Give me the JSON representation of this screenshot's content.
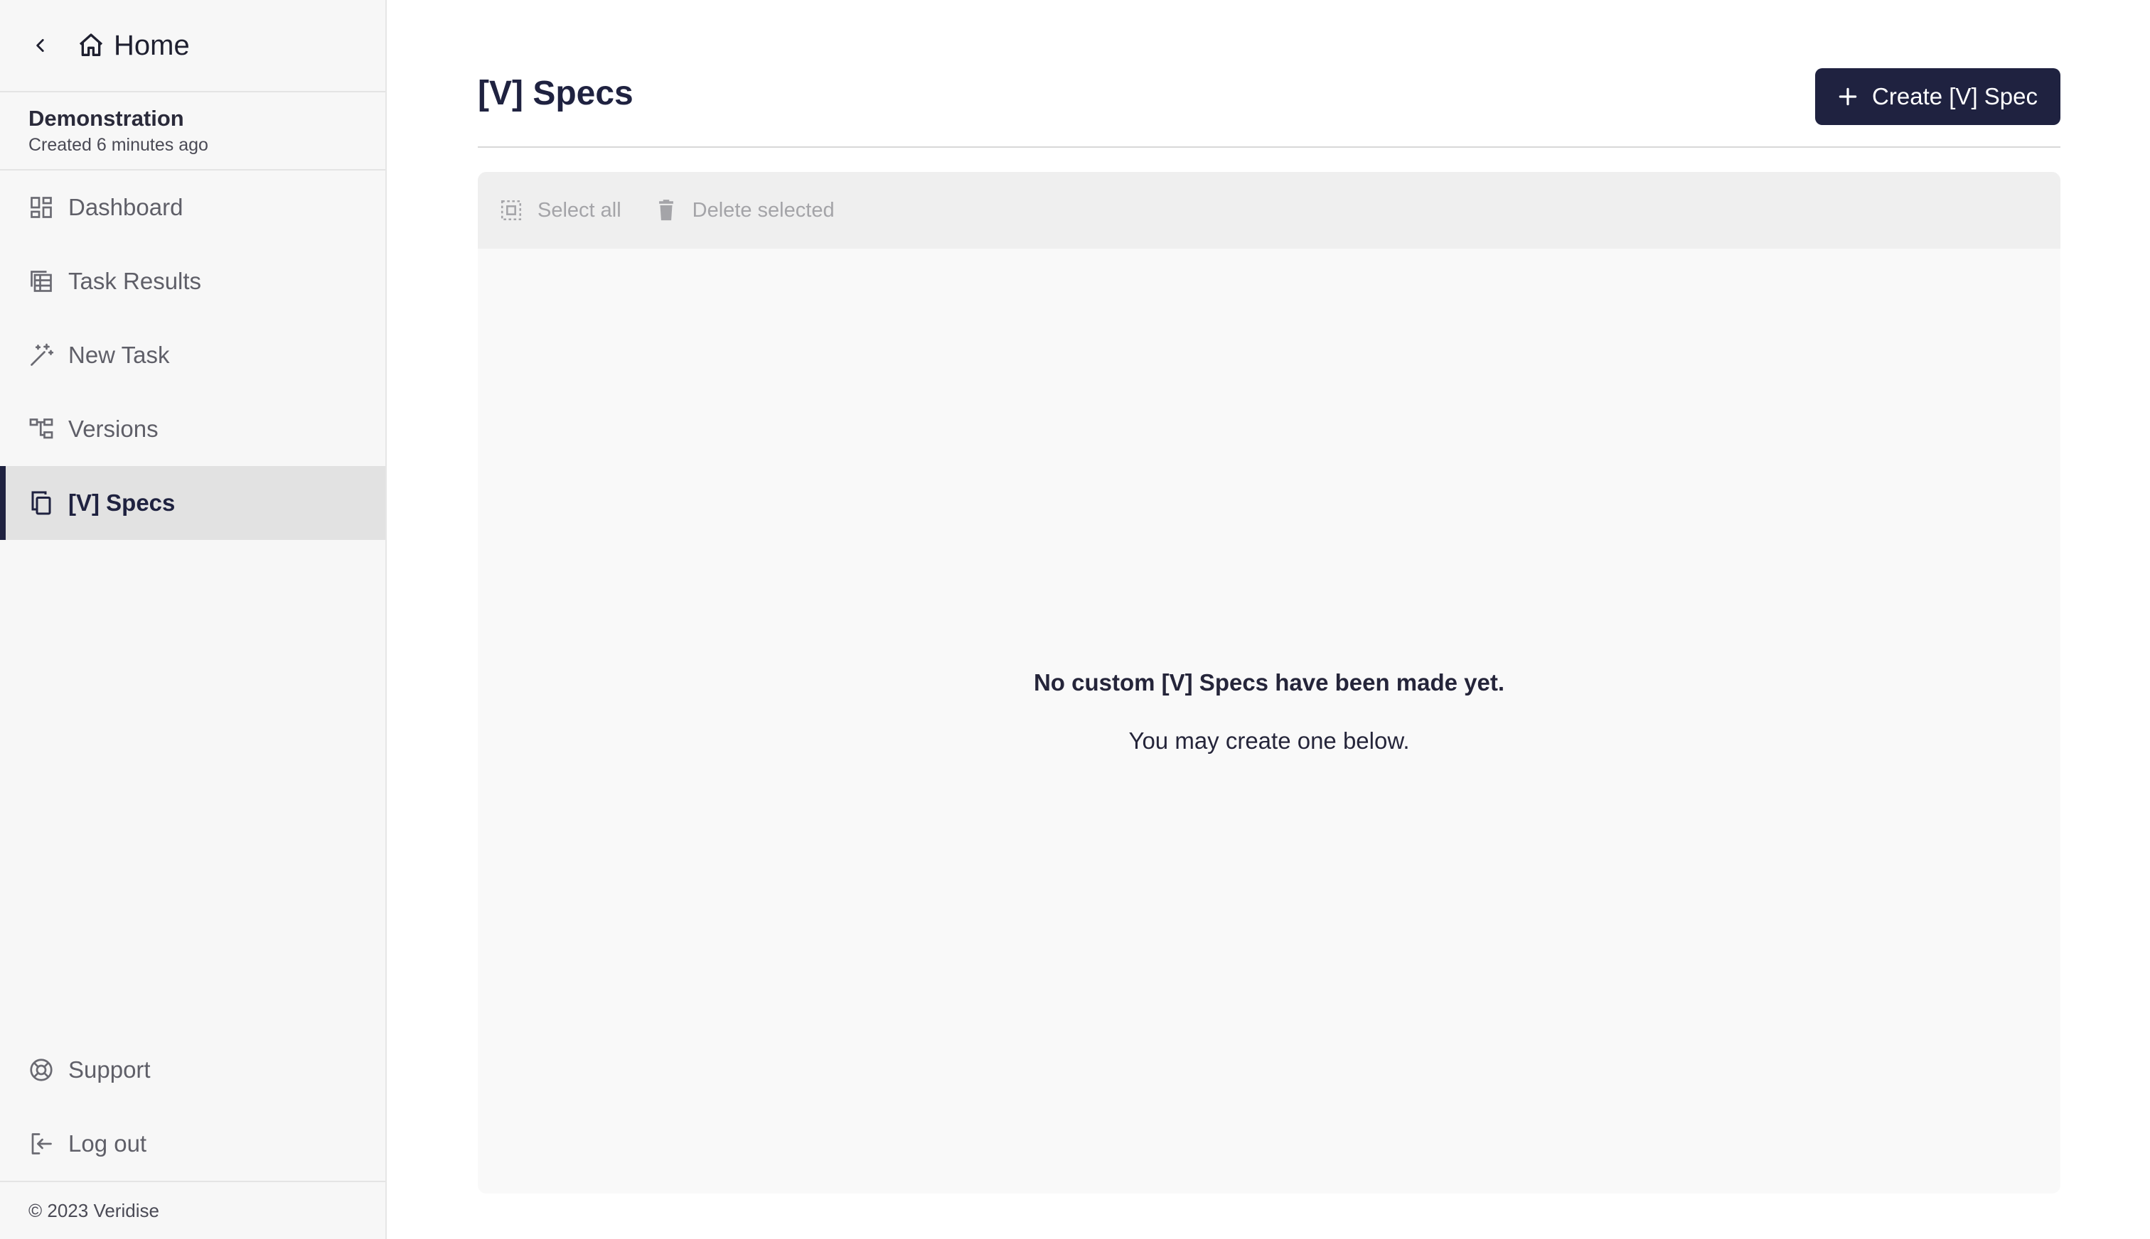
{
  "sidebar": {
    "home_label": "Home",
    "project_name": "Demonstration",
    "project_meta": "Created 6 minutes ago",
    "items": [
      {
        "label": "Dashboard",
        "icon": "dashboard-icon"
      },
      {
        "label": "Task Results",
        "icon": "table-icon"
      },
      {
        "label": "New Task",
        "icon": "magic-wand-icon"
      },
      {
        "label": "Versions",
        "icon": "tree-icon"
      },
      {
        "label": "[V] Specs",
        "icon": "copy-icon",
        "active": true
      }
    ],
    "support_label": "Support",
    "logout_label": "Log out",
    "copyright": "© 2023 Veridise"
  },
  "main": {
    "title": "[V] Specs",
    "create_label": "Create [V] Spec",
    "toolbar": {
      "select_all": "Select all",
      "delete_selected": "Delete selected"
    },
    "empty": {
      "headline": "No custom [V] Specs have been made yet.",
      "sub": "You may create one below."
    }
  },
  "colors": {
    "accent": "#1f2240",
    "sidebar_bg": "#f7f7f7",
    "active_bg": "#e2e2e2",
    "panel_bg": "#f9f9f9",
    "toolbar_bg": "#efefef"
  }
}
